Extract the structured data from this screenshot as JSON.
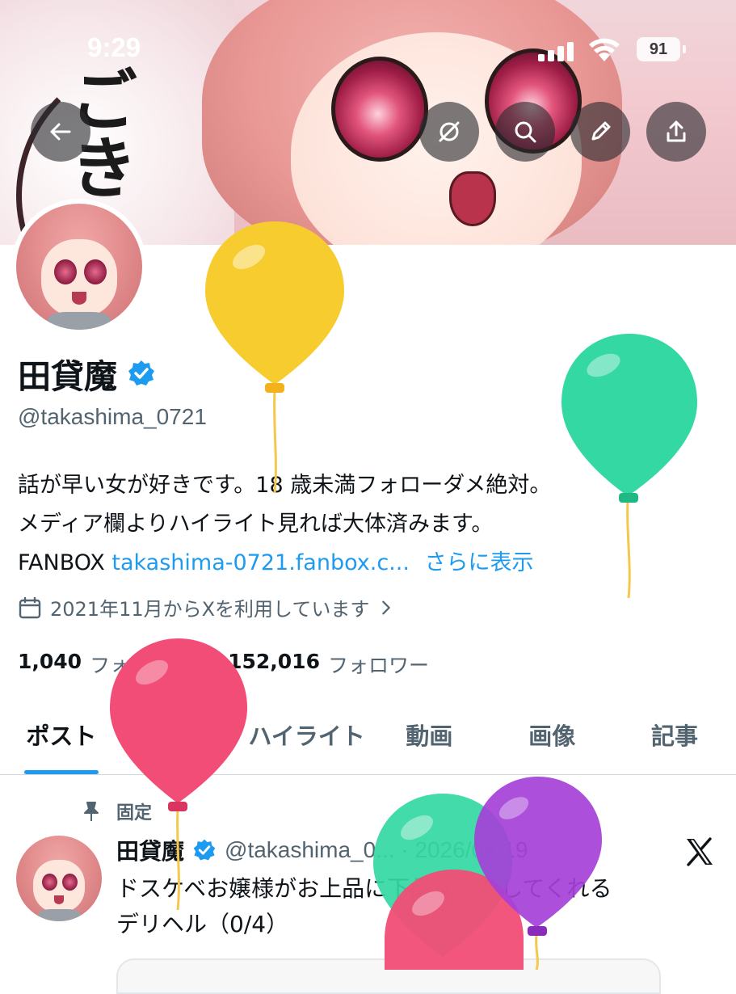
{
  "status_bar": {
    "time": "9:29",
    "battery": "91"
  },
  "header_buttons": {
    "back": "back-arrow-icon",
    "grok": "grok-icon",
    "search": "search-icon",
    "edit": "pencil-icon",
    "share": "share-icon"
  },
  "profile": {
    "name": "田貸魔",
    "handle": "@takashima_0721",
    "bio_line1": "話が早い女が好きです。18 歳未満フォローダメ絶対。",
    "bio_line2": "メディア欄よりハイライト見れば大体済みます。",
    "bio_prefix": "FANBOX ",
    "bio_link": "takashima-0721.fanbox.c...",
    "show_more": "さらに表示",
    "joined": "2021年11月からXを利用しています",
    "following_count": "1,040",
    "following_label": "フォロー中",
    "followers_count": "152,016",
    "followers_label": "フォロワー"
  },
  "tabs": [
    "ポスト",
    "返信",
    "ハイライト",
    "動画",
    "画像",
    "記事"
  ],
  "active_tab": "ポスト",
  "pinned_post": {
    "pinned_label": "固定",
    "author": "田貸魔",
    "meta": "@takashima_0... · 2026/04/19",
    "text_line1": "ドスケベお嬢様がお上品に下品なことしてくれる",
    "text_line2": "デリヘル（0/4）"
  },
  "colors": {
    "accent": "#1d9bf0",
    "text": "#0f1419",
    "muted": "#536471",
    "balloon_yellow": "#f7cc2e",
    "balloon_green": "#33d8a2",
    "balloon_pink": "#f24d76",
    "balloon_purple": "#a540d8"
  }
}
